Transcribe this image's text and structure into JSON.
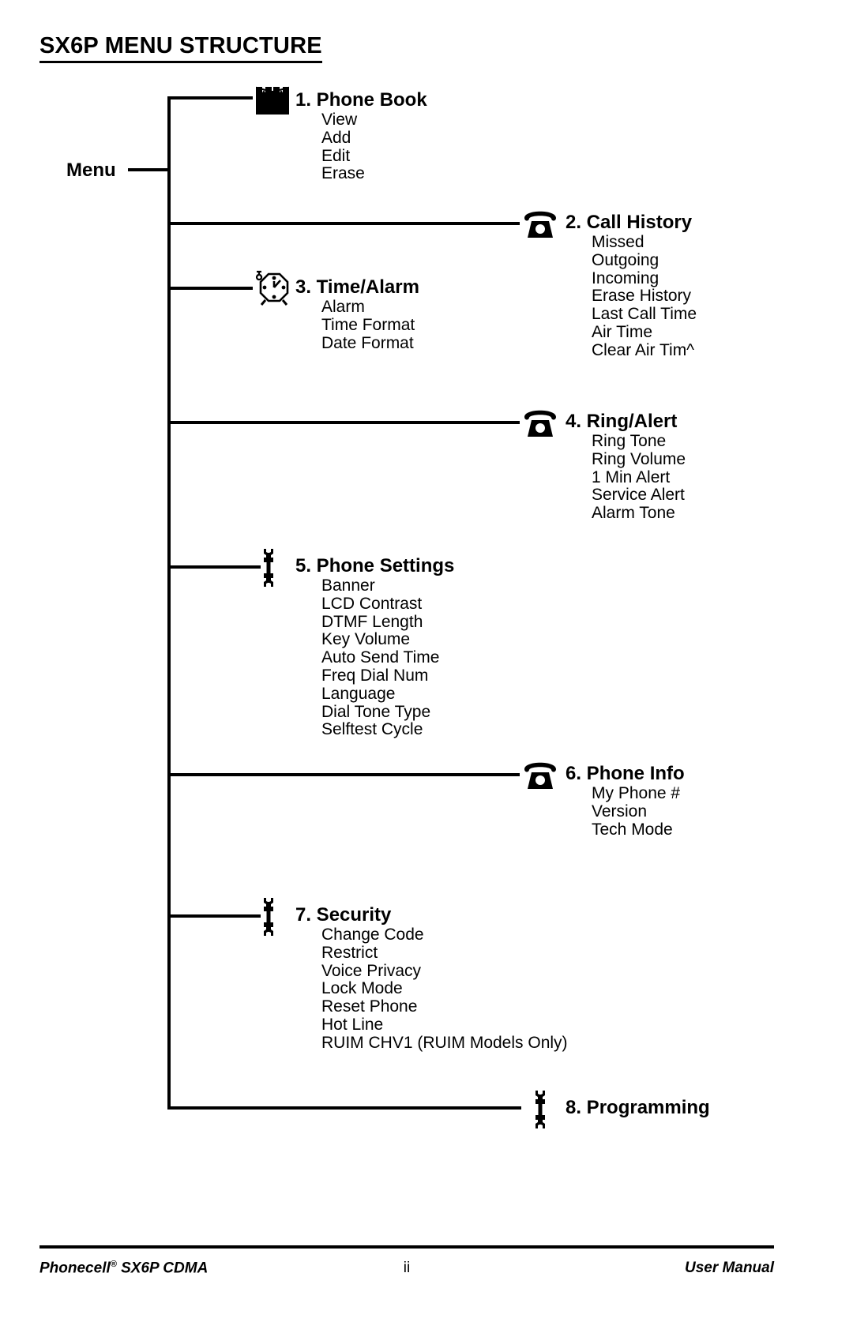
{
  "document": {
    "title": "SX6P MENU STRUCTURE",
    "root_label": "Menu"
  },
  "menu": {
    "items": [
      {
        "number": "1.",
        "title": "1. Phone Book",
        "icon": "open-book-icon",
        "subitems": [
          "View",
          "Add",
          "Edit",
          "Erase"
        ]
      },
      {
        "number": "2.",
        "title": "2. Call History",
        "icon": "telephone-icon",
        "subitems": [
          "Missed",
          "Outgoing",
          "Incoming",
          "Erase History",
          "Last Call Time",
          "Air Time",
          "Clear Air Tim^"
        ]
      },
      {
        "number": "3.",
        "title": "3. Time/Alarm",
        "icon": "alarm-clock-icon",
        "subitems": [
          "Alarm",
          "Time Format",
          "Date Format"
        ]
      },
      {
        "number": "4.",
        "title": "4. Ring/Alert",
        "icon": "telephone-icon",
        "subitems": [
          "Ring Tone",
          "Ring Volume",
          "1 Min Alert",
          "Service Alert",
          "Alarm Tone"
        ]
      },
      {
        "number": "5.",
        "title": "5. Phone Settings",
        "icon": "wrench-icon",
        "subitems": [
          "Banner",
          "LCD Contrast",
          "DTMF Length",
          "Key Volume",
          "Auto Send Time",
          "Freq Dial Num",
          "Language",
          "Dial Tone Type",
          "Selftest Cycle"
        ]
      },
      {
        "number": "6.",
        "title": "6. Phone Info",
        "icon": "telephone-icon",
        "subitems": [
          "My Phone #",
          "Version",
          "Tech Mode"
        ]
      },
      {
        "number": "7.",
        "title": "7. Security",
        "icon": "wrench-icon",
        "subitems": [
          "Change Code",
          "Restrict",
          "Voice Privacy",
          "Lock Mode",
          "Reset Phone",
          "Hot Line",
          "RUIM CHV1 (RUIM Models Only)"
        ]
      },
      {
        "number": "8.",
        "title": "8. Programming",
        "icon": "wrench-icon",
        "subitems": []
      }
    ]
  },
  "footer": {
    "left_text": "Phonecell",
    "left_mark": "®",
    "left_rest": " SX6P CDMA",
    "page_number": "ii",
    "right_text": "User Manual"
  }
}
